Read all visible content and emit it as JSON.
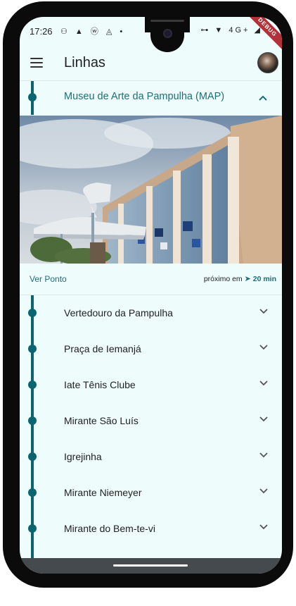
{
  "status_bar": {
    "time": "17:26",
    "left_icons": "⚇ ▲ ⓦ ◬ •",
    "right_icons": "⊶ ▼ 4G+ ◢",
    "debug_banner": "DEBUG"
  },
  "app_bar": {
    "title": "Linhas"
  },
  "expanded_stop": {
    "name": "Museu de Arte da Pampulha (MAP)",
    "action": "Ver Ponto",
    "next_prefix": "próximo em",
    "next_time": "20 min"
  },
  "stops": [
    {
      "name": "Vertedouro da Pampulha"
    },
    {
      "name": "Praça de Iemanjá"
    },
    {
      "name": "Iate Tênis Clube"
    },
    {
      "name": "Mirante São Luís"
    },
    {
      "name": "Igrejinha"
    },
    {
      "name": "Mirante Niemeyer"
    },
    {
      "name": "Mirante do Bem-te-vi"
    }
  ],
  "colors": {
    "accent": "#1e6e78",
    "track": "#0a6570",
    "background": "#eefcfc"
  }
}
